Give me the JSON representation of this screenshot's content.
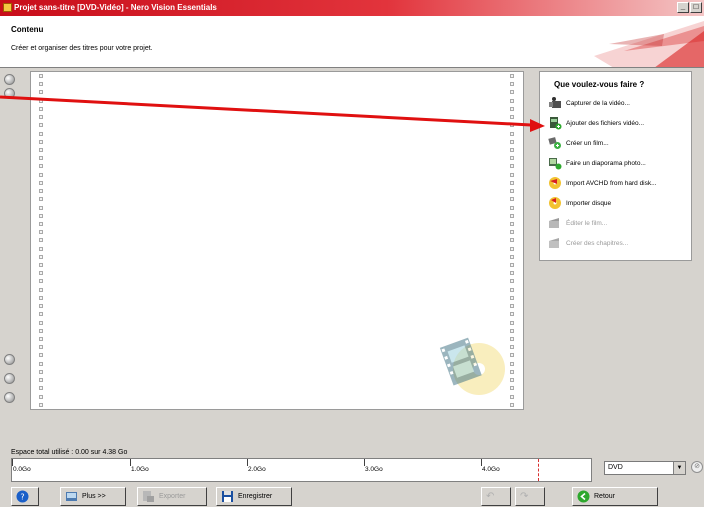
{
  "window": {
    "title": "Projet sans-titre [DVD-Vidéo] - Nero Vision Essentials"
  },
  "header": {
    "title": "Contenu",
    "subtitle": "Créer et organiser des titres pour votre projet."
  },
  "panel": {
    "title": "Que voulez-vous faire ?",
    "items": [
      {
        "label": "Capturer de la vidéo...",
        "icon": "camera-icon",
        "enabled": true
      },
      {
        "label": "Ajouter des fichiers vidéo...",
        "icon": "add-video-icon",
        "enabled": true
      },
      {
        "label": "Créer un film...",
        "icon": "create-movie-icon",
        "enabled": true
      },
      {
        "label": "Faire un diaporama photo...",
        "icon": "slideshow-icon",
        "enabled": true
      },
      {
        "label": "Import AVCHD from hard disk...",
        "icon": "avchd-import-icon",
        "enabled": true
      },
      {
        "label": "Importer disque",
        "icon": "import-disc-icon",
        "enabled": true
      },
      {
        "label": "Éditer le film...",
        "icon": "edit-movie-icon",
        "enabled": false
      },
      {
        "label": "Créer des chapitres...",
        "icon": "chapters-icon",
        "enabled": false
      }
    ]
  },
  "usage": {
    "label": "Espace total utilisé : 0.00 sur 4.38 Go",
    "ticks": [
      "0.0Go",
      "1.0Go",
      "2.0Go",
      "3.0Go",
      "4.0Go"
    ],
    "used_fraction": 0.0
  },
  "disc_type": {
    "selected": "DVD"
  },
  "buttons": {
    "more": "Plus >>",
    "export": "Exporter",
    "save": "Enregistrer",
    "back": "Retour"
  },
  "colors": {
    "titlebar": "#c80d1a",
    "arrow": "#e01010"
  }
}
